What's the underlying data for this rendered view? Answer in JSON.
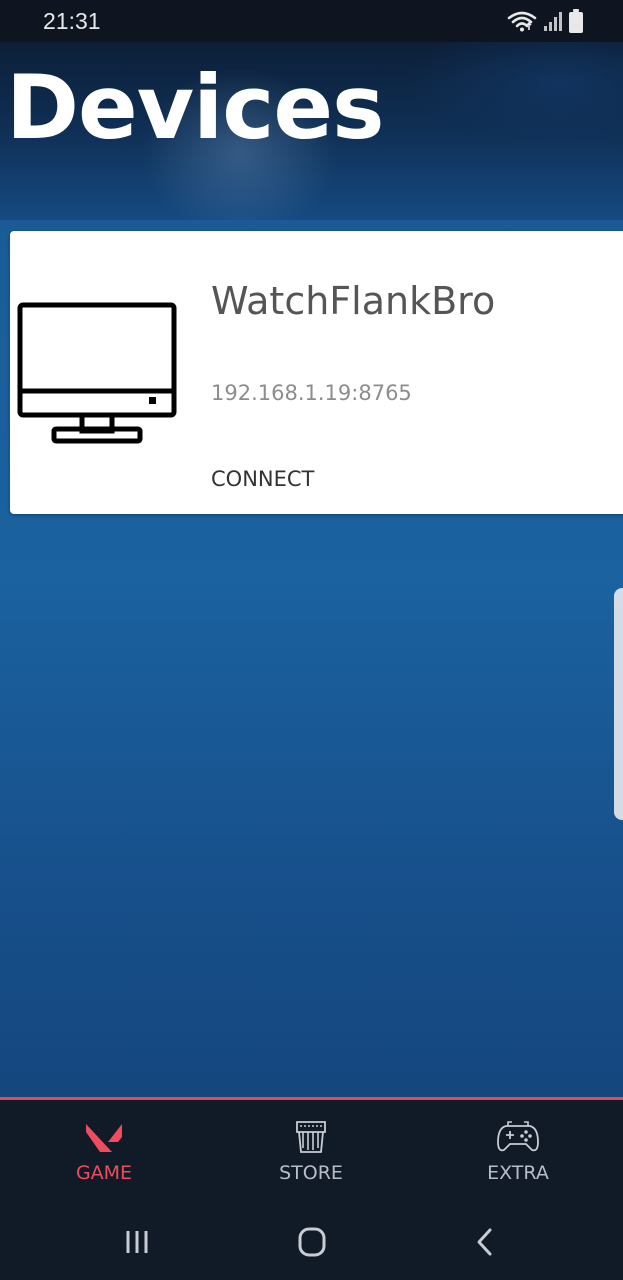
{
  "status_bar": {
    "time": "21:31",
    "icons": [
      "wifi-icon",
      "signal-icon",
      "battery-icon"
    ]
  },
  "header": {
    "title": "Devices"
  },
  "devices": [
    {
      "name": "WatchFlankBro",
      "address": "192.168.1.19:8765",
      "action_label": "CONNECT",
      "icon": "monitor-icon"
    }
  ],
  "bottom_nav": {
    "items": [
      {
        "label": "GAME",
        "icon": "valorant-logo-icon",
        "active": true
      },
      {
        "label": "STORE",
        "icon": "store-icon",
        "active": false
      },
      {
        "label": "EXTRA",
        "icon": "gamepad-icon",
        "active": false
      }
    ],
    "accent_color": "#f04c5d"
  },
  "system_nav": {
    "buttons": [
      "recent-apps-icon",
      "home-icon",
      "back-icon"
    ]
  }
}
